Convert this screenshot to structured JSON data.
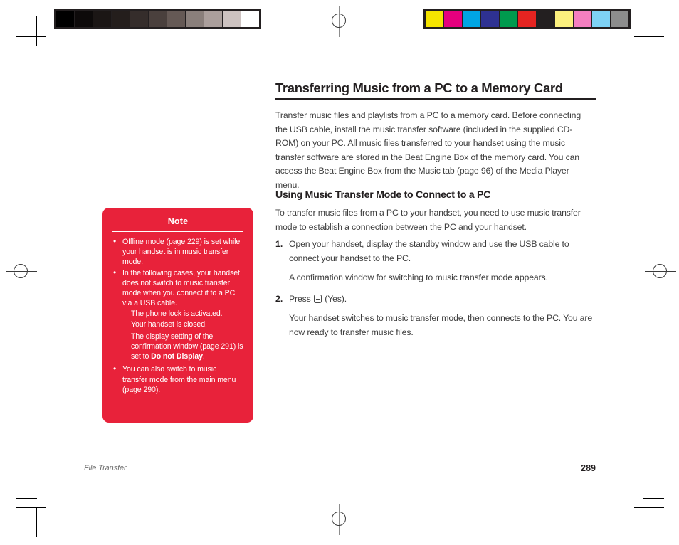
{
  "document": {
    "title": "Transferring Music from a PC to a Memory Card",
    "intro": "Transfer music files and playlists from a PC to a memory card. Before connecting the USB cable, install the music transfer software (included in the supplied CD-ROM) on your PC. All music files transferred to your handset using the music transfer software are stored in the Beat Engine Box of the memory card. You can access the Beat Engine Box from the Music tab (page 96) of the Media Player menu.",
    "section": {
      "heading": "Using Music Transfer Mode to Connect to a PC",
      "intro": "To transfer music files from a PC to your handset, you need to use music transfer mode to establish a connection between the PC and your handset.",
      "steps": [
        {
          "number": "1.",
          "text": "Open your handset, display the standby window and use the USB cable to connect your handset to the PC.",
          "result": "A confirmation window for switching to music transfer mode appears."
        },
        {
          "number": "2.",
          "text_before_key": "Press",
          "text_after_key": "(Yes).",
          "key_icon": "soft-key-icon",
          "result": "Your handset switches to music transfer mode, then connects to the PC. You are now ready to transfer music files."
        }
      ]
    }
  },
  "note_box": {
    "heading": "Note",
    "background_color": "#e8223a",
    "items": [
      "Offline mode (page 229) is set while your handset is in music transfer mode.",
      "In the following cases, your handset does not switch to music transfer mode when you connect it to a PC via a USB cable.",
      "You can also switch to music transfer mode from the main menu (page 290)."
    ],
    "sub_items": [
      "The phone lock is activated.",
      "Your handset is closed.",
      "The display setting of the confirmation window (page 291) is set to ",
      "Do not Display",
      "."
    ]
  },
  "footer": {
    "chapter": "File Transfer",
    "page_number": "289"
  },
  "print_marks": {
    "gray_bar_patches": [
      "#000000",
      "#0d0a0a",
      "#1b1615",
      "#241e1c",
      "#352d2b",
      "#4a403d",
      "#655955",
      "#8a7f7b",
      "#ab9f9c",
      "#cdc2c0",
      "#ffffff"
    ],
    "color_bar_patches": [
      "#f5e400",
      "#e5007e",
      "#00a5e3",
      "#2e3192",
      "#009a4e",
      "#e52421",
      "#231f20",
      "#fcf07e",
      "#f47fc0",
      "#7ed2f5",
      "#8d8d8d"
    ]
  }
}
